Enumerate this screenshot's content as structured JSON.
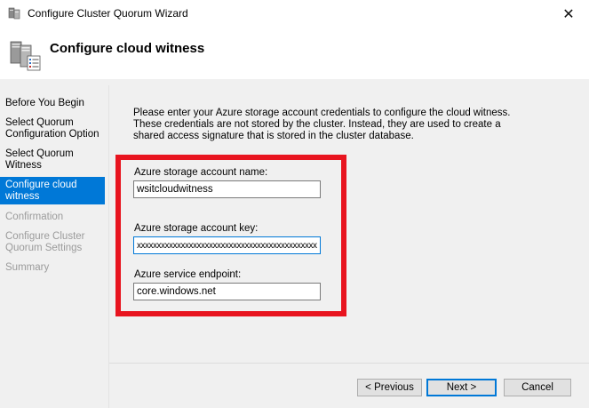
{
  "window": {
    "title": "Configure Cluster Quorum Wizard",
    "close_glyph": "✕"
  },
  "header": {
    "title": "Configure cloud witness",
    "icon": "cluster-server-icon"
  },
  "sidebar": {
    "items": [
      {
        "label": "Before You Begin",
        "state": "normal"
      },
      {
        "label": "Select Quorum Configuration Option",
        "state": "normal"
      },
      {
        "label": "Select Quorum Witness",
        "state": "normal"
      },
      {
        "label": "Configure cloud witness",
        "state": "active"
      },
      {
        "label": "Confirmation",
        "state": "disabled"
      },
      {
        "label": "Configure Cluster Quorum Settings",
        "state": "disabled"
      },
      {
        "label": "Summary",
        "state": "disabled"
      }
    ]
  },
  "main": {
    "intro": "Please enter your Azure storage account credentials to configure the cloud witness. These credentials are not stored by the cluster. Instead, they are used to create a shared access signature that is stored in the cluster database.",
    "fields": {
      "account_name": {
        "label": "Azure storage account name:",
        "value": "wsitcloudwitness"
      },
      "account_key": {
        "label": "Azure storage account key:",
        "value": "xxxxxxxxxxxxxxxxxxxxxxxxxxxxxxxxxxxxxxxxxxxxxxxx"
      },
      "endpoint": {
        "label": "Azure service endpoint:",
        "value": "core.windows.net"
      }
    },
    "highlight_color": "#e8141f"
  },
  "footer": {
    "previous_label": "< Previous",
    "next_label": "Next >",
    "cancel_label": "Cancel"
  },
  "colors": {
    "accent": "#0078d7",
    "panel": "#f0f0f0"
  }
}
